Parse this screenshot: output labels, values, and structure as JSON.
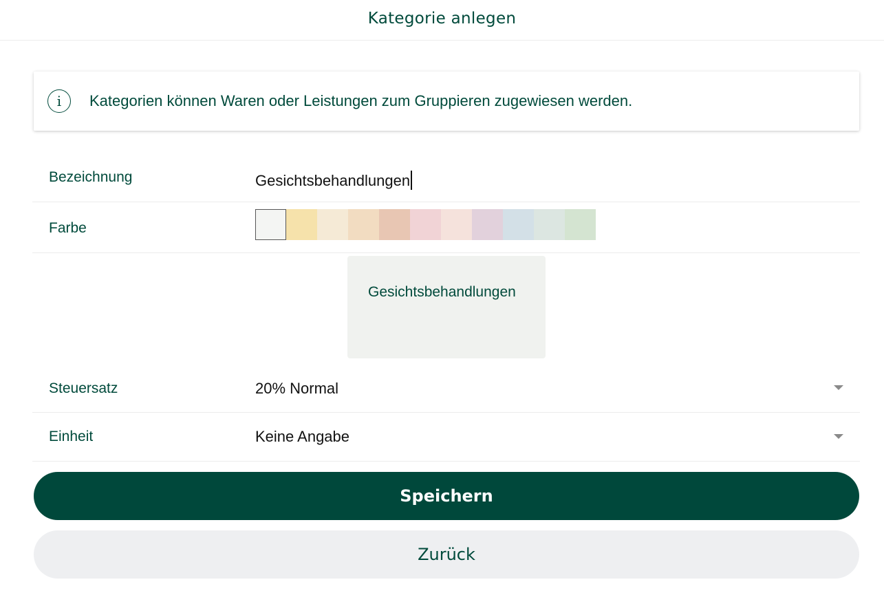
{
  "header": {
    "title": "Kategorie anlegen"
  },
  "info": {
    "icon": "info-icon",
    "glyph": "i",
    "text": "Kategorien können Waren oder Leistungen zum Gruppieren zugewiesen werden."
  },
  "form": {
    "name": {
      "label": "Bezeichnung",
      "value": "Gesichtsbehandlungen"
    },
    "color": {
      "label": "Farbe",
      "swatches": [
        "#f4f5f3",
        "#f6e2ab",
        "#f5ead6",
        "#f2dcc1",
        "#e8c6b3",
        "#f1d3d6",
        "#f5e2dc",
        "#e2d1dc",
        "#d3e0e7",
        "#dce6e1",
        "#d4e4d1"
      ],
      "selected_index": 0
    },
    "preview": {
      "text": "Gesichtsbehandlungen"
    },
    "tax": {
      "label": "Steuersatz",
      "value": "20% Normal"
    },
    "unit": {
      "label": "Einheit",
      "value": "Keine Angabe"
    }
  },
  "actions": {
    "save_label": "Speichern",
    "back_label": "Zurück"
  }
}
